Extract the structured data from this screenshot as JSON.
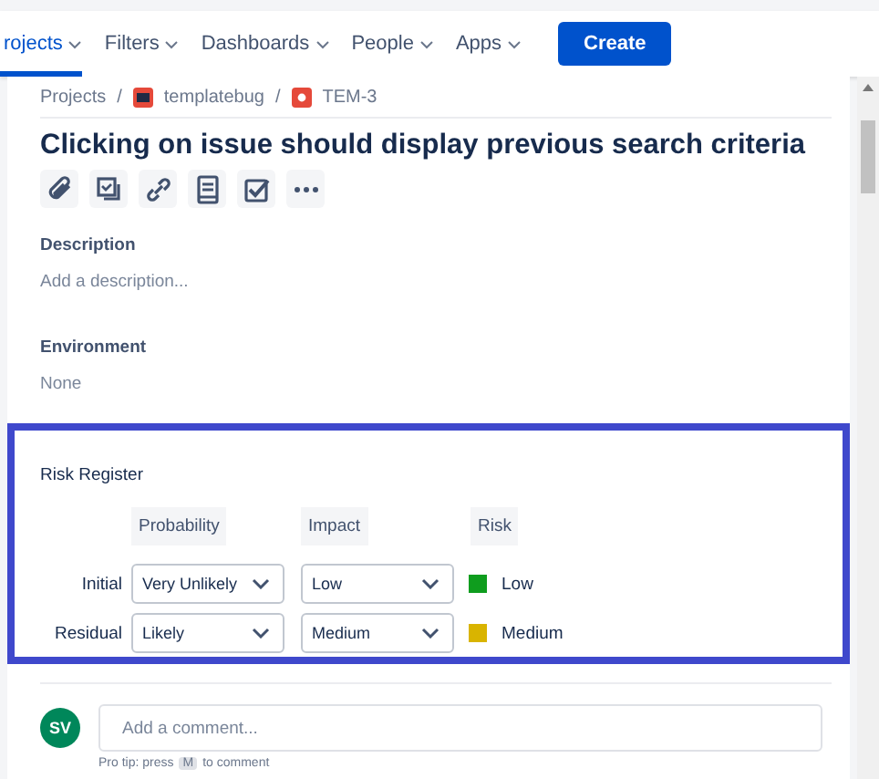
{
  "nav": {
    "items": [
      {
        "label": "rojects",
        "selected": true
      },
      {
        "label": "Filters",
        "selected": false
      },
      {
        "label": "Dashboards",
        "selected": false
      },
      {
        "label": "People",
        "selected": false
      },
      {
        "label": "Apps",
        "selected": false
      }
    ],
    "create": "Create"
  },
  "breadcrumb": {
    "items": [
      "Projects",
      "templatebug",
      "TEM-3"
    ],
    "separators": [
      "/",
      "/"
    ]
  },
  "title": "Clicking on issue should display previous search criteria",
  "description": {
    "label": "Description",
    "placeholder": "Add a description..."
  },
  "environment": {
    "label": "Environment",
    "value": "None"
  },
  "risk": {
    "title": "Risk Register",
    "columns": [
      "Probability",
      "Impact",
      "Risk"
    ],
    "rows": [
      {
        "label": "Initial",
        "probability": "Very Unlikely",
        "impact": "Low",
        "risk": "Low",
        "color": "#0f9d1e"
      },
      {
        "label": "Residual",
        "probability": "Likely",
        "impact": "Medium",
        "risk": "Medium",
        "color": "#d9b400"
      }
    ]
  },
  "comment": {
    "avatar": "SV",
    "placeholder": "Add a comment...",
    "tip": [
      "Pro tip: press",
      "M",
      "to comment"
    ]
  }
}
